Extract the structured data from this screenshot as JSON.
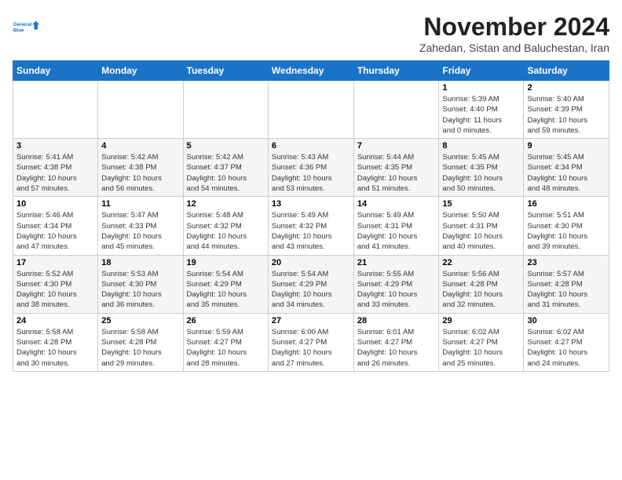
{
  "header": {
    "logo_line1": "General",
    "logo_line2": "Blue",
    "month_title": "November 2024",
    "location": "Zahedan, Sistan and Baluchestan, Iran"
  },
  "weekdays": [
    "Sunday",
    "Monday",
    "Tuesday",
    "Wednesday",
    "Thursday",
    "Friday",
    "Saturday"
  ],
  "weeks": [
    [
      {
        "day": "",
        "info": ""
      },
      {
        "day": "",
        "info": ""
      },
      {
        "day": "",
        "info": ""
      },
      {
        "day": "",
        "info": ""
      },
      {
        "day": "",
        "info": ""
      },
      {
        "day": "1",
        "info": "Sunrise: 5:39 AM\nSunset: 4:40 PM\nDaylight: 11 hours\nand 0 minutes."
      },
      {
        "day": "2",
        "info": "Sunrise: 5:40 AM\nSunset: 4:39 PM\nDaylight: 10 hours\nand 59 minutes."
      }
    ],
    [
      {
        "day": "3",
        "info": "Sunrise: 5:41 AM\nSunset: 4:38 PM\nDaylight: 10 hours\nand 57 minutes."
      },
      {
        "day": "4",
        "info": "Sunrise: 5:42 AM\nSunset: 4:38 PM\nDaylight: 10 hours\nand 56 minutes."
      },
      {
        "day": "5",
        "info": "Sunrise: 5:42 AM\nSunset: 4:37 PM\nDaylight: 10 hours\nand 54 minutes."
      },
      {
        "day": "6",
        "info": "Sunrise: 5:43 AM\nSunset: 4:36 PM\nDaylight: 10 hours\nand 53 minutes."
      },
      {
        "day": "7",
        "info": "Sunrise: 5:44 AM\nSunset: 4:35 PM\nDaylight: 10 hours\nand 51 minutes."
      },
      {
        "day": "8",
        "info": "Sunrise: 5:45 AM\nSunset: 4:35 PM\nDaylight: 10 hours\nand 50 minutes."
      },
      {
        "day": "9",
        "info": "Sunrise: 5:45 AM\nSunset: 4:34 PM\nDaylight: 10 hours\nand 48 minutes."
      }
    ],
    [
      {
        "day": "10",
        "info": "Sunrise: 5:46 AM\nSunset: 4:34 PM\nDaylight: 10 hours\nand 47 minutes."
      },
      {
        "day": "11",
        "info": "Sunrise: 5:47 AM\nSunset: 4:33 PM\nDaylight: 10 hours\nand 45 minutes."
      },
      {
        "day": "12",
        "info": "Sunrise: 5:48 AM\nSunset: 4:32 PM\nDaylight: 10 hours\nand 44 minutes."
      },
      {
        "day": "13",
        "info": "Sunrise: 5:49 AM\nSunset: 4:32 PM\nDaylight: 10 hours\nand 43 minutes."
      },
      {
        "day": "14",
        "info": "Sunrise: 5:49 AM\nSunset: 4:31 PM\nDaylight: 10 hours\nand 41 minutes."
      },
      {
        "day": "15",
        "info": "Sunrise: 5:50 AM\nSunset: 4:31 PM\nDaylight: 10 hours\nand 40 minutes."
      },
      {
        "day": "16",
        "info": "Sunrise: 5:51 AM\nSunset: 4:30 PM\nDaylight: 10 hours\nand 39 minutes."
      }
    ],
    [
      {
        "day": "17",
        "info": "Sunrise: 5:52 AM\nSunset: 4:30 PM\nDaylight: 10 hours\nand 38 minutes."
      },
      {
        "day": "18",
        "info": "Sunrise: 5:53 AM\nSunset: 4:30 PM\nDaylight: 10 hours\nand 36 minutes."
      },
      {
        "day": "19",
        "info": "Sunrise: 5:54 AM\nSunset: 4:29 PM\nDaylight: 10 hours\nand 35 minutes."
      },
      {
        "day": "20",
        "info": "Sunrise: 5:54 AM\nSunset: 4:29 PM\nDaylight: 10 hours\nand 34 minutes."
      },
      {
        "day": "21",
        "info": "Sunrise: 5:55 AM\nSunset: 4:29 PM\nDaylight: 10 hours\nand 33 minutes."
      },
      {
        "day": "22",
        "info": "Sunrise: 5:56 AM\nSunset: 4:28 PM\nDaylight: 10 hours\nand 32 minutes."
      },
      {
        "day": "23",
        "info": "Sunrise: 5:57 AM\nSunset: 4:28 PM\nDaylight: 10 hours\nand 31 minutes."
      }
    ],
    [
      {
        "day": "24",
        "info": "Sunrise: 5:58 AM\nSunset: 4:28 PM\nDaylight: 10 hours\nand 30 minutes."
      },
      {
        "day": "25",
        "info": "Sunrise: 5:58 AM\nSunset: 4:28 PM\nDaylight: 10 hours\nand 29 minutes."
      },
      {
        "day": "26",
        "info": "Sunrise: 5:59 AM\nSunset: 4:27 PM\nDaylight: 10 hours\nand 28 minutes."
      },
      {
        "day": "27",
        "info": "Sunrise: 6:00 AM\nSunset: 4:27 PM\nDaylight: 10 hours\nand 27 minutes."
      },
      {
        "day": "28",
        "info": "Sunrise: 6:01 AM\nSunset: 4:27 PM\nDaylight: 10 hours\nand 26 minutes."
      },
      {
        "day": "29",
        "info": "Sunrise: 6:02 AM\nSunset: 4:27 PM\nDaylight: 10 hours\nand 25 minutes."
      },
      {
        "day": "30",
        "info": "Sunrise: 6:02 AM\nSunset: 4:27 PM\nDaylight: 10 hours\nand 24 minutes."
      }
    ]
  ]
}
